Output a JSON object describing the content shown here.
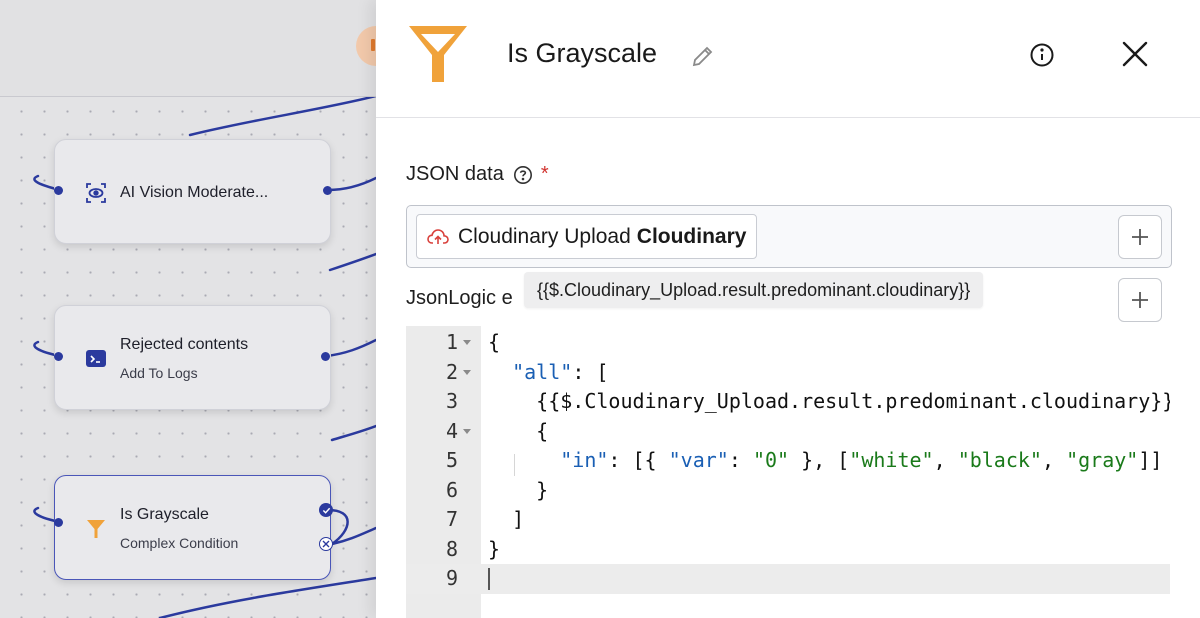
{
  "canvas": {
    "nodes": [
      {
        "title": "AI Vision Moderate...",
        "subtitle": "",
        "icon": "eye-scan-icon"
      },
      {
        "title": "Rejected contents",
        "subtitle": "Add To Logs",
        "icon": "terminal-icon"
      },
      {
        "title": "Is Grayscale",
        "subtitle": "Complex Condition",
        "icon": "filter-icon"
      }
    ],
    "colors": {
      "wire": "#2b3a9e",
      "selected_border": "#4a56b8",
      "filter_orange": "#f0a23a"
    }
  },
  "panel": {
    "title": "Is Grayscale",
    "icons": {
      "header": "filter-icon",
      "edit": "pencil-icon",
      "info": "info-icon",
      "close": "close-icon"
    },
    "json_data": {
      "label": "JSON data",
      "required_mark": "*",
      "chip_source": "Cloudinary Upload",
      "chip_app": "Cloudinary",
      "tooltip": "{{$.Cloudinary_Upload.result.predominant.cloudinary}}"
    },
    "jsonlogic": {
      "label": "JsonLogic e",
      "lines": [
        {
          "num": "1",
          "fold": true,
          "active": false
        },
        {
          "num": "2",
          "fold": true,
          "active": false
        },
        {
          "num": "3",
          "fold": false,
          "active": false
        },
        {
          "num": "4",
          "fold": true,
          "active": false
        },
        {
          "num": "5",
          "fold": false,
          "active": false
        },
        {
          "num": "6",
          "fold": false,
          "active": false
        },
        {
          "num": "7",
          "fold": false,
          "active": false
        },
        {
          "num": "8",
          "fold": false,
          "active": false
        },
        {
          "num": "9",
          "fold": false,
          "active": true
        }
      ],
      "code": {
        "l1": "{",
        "l2_key": "\"all\"",
        "l2_rest": ": [",
        "l3": "{{$.Cloudinary_Upload.result.predominant.cloudinary}},",
        "l4": "{",
        "l5_key": "\"in\"",
        "l5_a": ": [{ ",
        "l5_var": "\"var\"",
        "l5_b": ": ",
        "l5_zero": "\"0\"",
        "l5_c": " }, [",
        "l5_white": "\"white\"",
        "l5_d": ", ",
        "l5_black": "\"black\"",
        "l5_e": ", ",
        "l5_gray": "\"gray\"",
        "l5_f": "]]",
        "l6": "}",
        "l7": "]",
        "l8": "}",
        "l9": ""
      }
    }
  }
}
